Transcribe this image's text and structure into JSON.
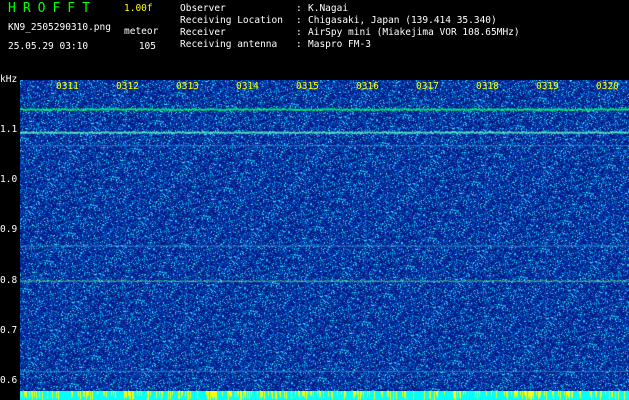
{
  "header": {
    "logo": "HROFFT",
    "version": "1.00f",
    "filename": "KN9_2505290310.png",
    "meteor_label": "meteor",
    "datetime": "25.05.29 03:10",
    "meteor_count": "105"
  },
  "info": [
    {
      "label": "Observer",
      "value": "K.Nagai"
    },
    {
      "label": "Receiving Location",
      "value": "Chigasaki, Japan (139.414 35.340)"
    },
    {
      "label": "Receiver",
      "value": "AirSpy mini (Miakejima VOR 108.65MHz)"
    },
    {
      "label": "Receiving antenna",
      "value": "Maspro FM-3"
    }
  ],
  "y_unit": "kHz",
  "y_axis": {
    "labels": [
      "1.1",
      "1.0",
      "0.9",
      "0.8",
      "0.7",
      "0.6"
    ],
    "range": [
      0.58,
      1.2
    ]
  },
  "x_axis": {
    "labels": [
      "0311",
      "0312",
      "0313",
      "0314",
      "0315",
      "0316",
      "0317",
      "0318",
      "0319",
      "0320"
    ]
  },
  "lines": [
    {
      "freq": 1.143,
      "color": "#00ff66",
      "strength": 1.0
    },
    {
      "freq": 1.097,
      "color": "#66ffcc",
      "strength": 0.8
    },
    {
      "freq": 1.07,
      "color": "#3fa0e0",
      "strength": 0.35
    },
    {
      "freq": 0.87,
      "color": "#4fb8e0",
      "strength": 0.4
    },
    {
      "freq": 0.8,
      "color": "#66ff88",
      "strength": 0.7
    },
    {
      "freq": 0.62,
      "color": "#3fa0e0",
      "strength": 0.3
    }
  ],
  "colors": {
    "background": "#0a1a8a",
    "noise_bright": "#00b4ff",
    "logo": "#00ff00",
    "tick_label": "#ffff00",
    "bar_cyan": "#00ffff",
    "bar_yellow": "#ffff00"
  }
}
